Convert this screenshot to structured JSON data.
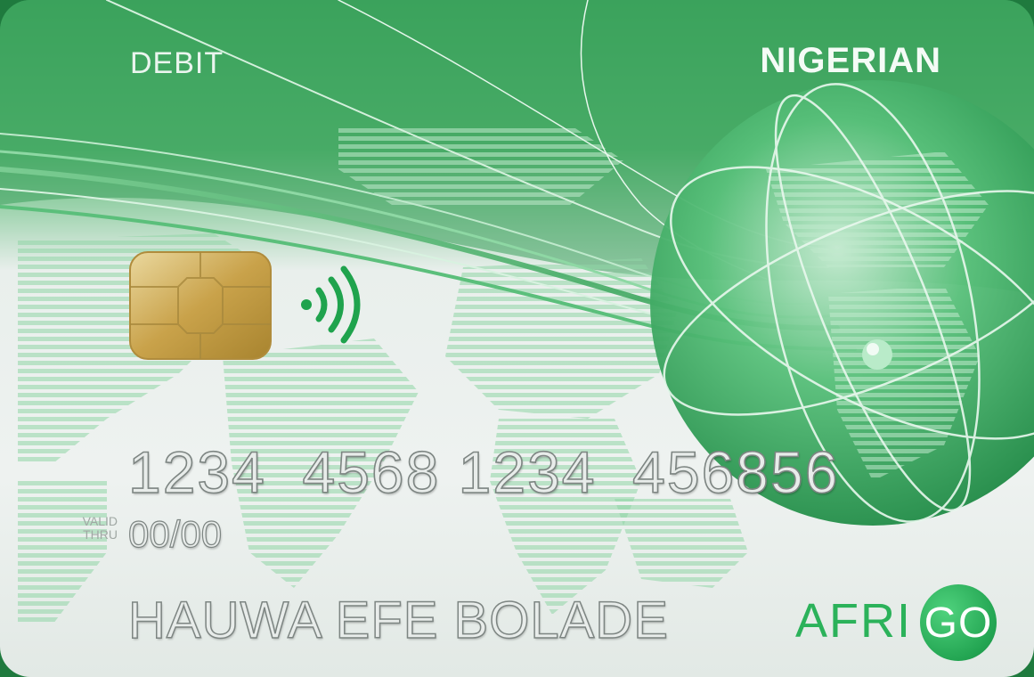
{
  "card": {
    "type": "DEBIT",
    "country": "NIGERIAN",
    "number": "1234  4568 1234  456856",
    "valid_label_line1": "VALID",
    "valid_label_line2": "THRU",
    "valid_thru": "00/00",
    "holder_name": "HAUWA EFE BOLADE",
    "brand_part1": "AFRI",
    "brand_part2": "GO"
  },
  "colors": {
    "brand_green": "#2bb25a",
    "card_dark_green": "#1f7a3e",
    "chip_gold": "#c9a24a"
  },
  "icons": {
    "chip": "emv-chip-icon",
    "contactless": "contactless-icon",
    "globe": "globe-icon"
  }
}
